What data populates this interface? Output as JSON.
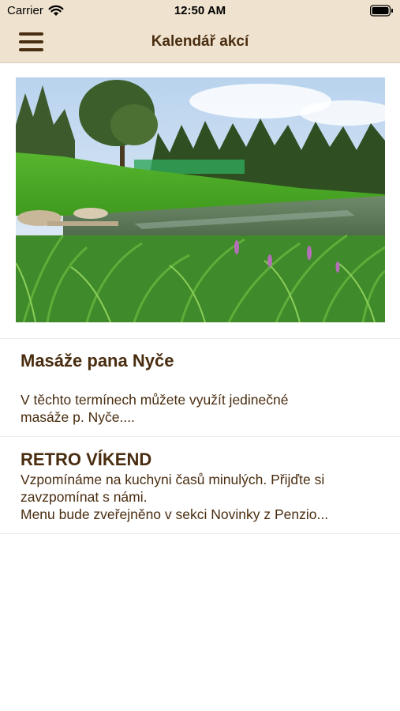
{
  "status_bar": {
    "carrier": "Carrier",
    "time": "12:50 AM",
    "icons": [
      "wifi-icon",
      "battery-icon"
    ]
  },
  "nav": {
    "title": "Kalendář akcí",
    "menu_icon": "hamburger-menu-icon"
  },
  "colors": {
    "bar_background": "#efe3cf",
    "text_brown": "#4a2d10"
  },
  "events": [
    {
      "title": "Masáže pana Nyče",
      "description": "V těchto termínech můžete využít jedinečné\nmasáže p. Nyče...."
    },
    {
      "title": "RETRO VÍKEND",
      "description": "Vzpomínáme na kuchyni časů minulých. Přijďte si\nzavzpomínat s námi.\nMenu bude zveřejněno v sekci Novinky z Penzio..."
    }
  ]
}
